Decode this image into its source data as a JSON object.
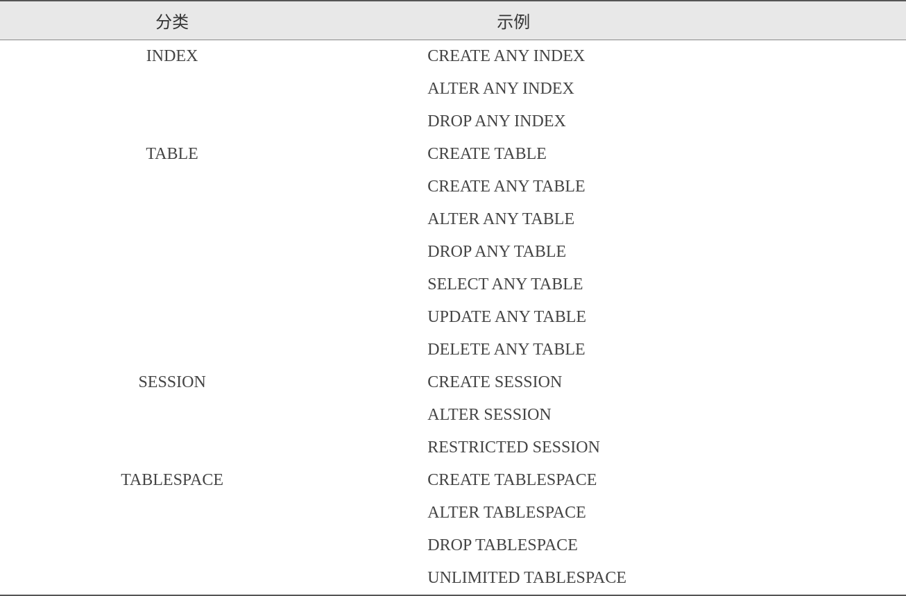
{
  "table": {
    "headers": {
      "category": "分类",
      "example": "示例"
    },
    "groups": [
      {
        "category": "INDEX",
        "examples": [
          "CREATE ANY INDEX",
          "ALTER ANY INDEX",
          "DROP ANY INDEX"
        ]
      },
      {
        "category": "TABLE",
        "examples": [
          "CREATE TABLE",
          "CREATE ANY TABLE",
          "ALTER ANY TABLE",
          "DROP ANY TABLE",
          "SELECT ANY TABLE",
          "UPDATE ANY TABLE",
          "DELETE ANY TABLE"
        ]
      },
      {
        "category": "SESSION",
        "examples": [
          "CREATE SESSION",
          "ALTER SESSION",
          "RESTRICTED SESSION"
        ]
      },
      {
        "category": "TABLESPACE",
        "examples": [
          "CREATE TABLESPACE",
          "ALTER TABLESPACE",
          "DROP TABLESPACE",
          "UNLIMITED TABLESPACE"
        ]
      }
    ]
  }
}
